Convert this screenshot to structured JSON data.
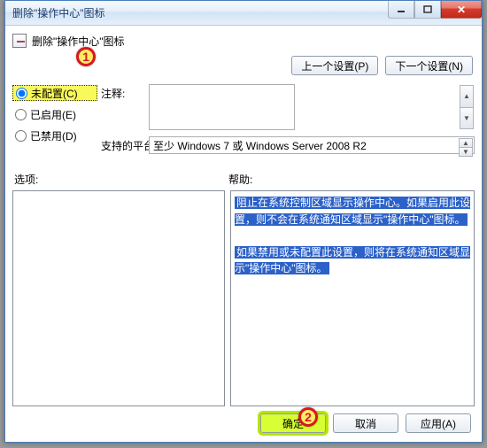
{
  "window": {
    "title": "删除\"操作中心\"图标",
    "header_text": "删除\"操作中心\"图标"
  },
  "nav": {
    "prev": "上一个设置(P)",
    "next": "下一个设置(N)"
  },
  "radios": {
    "not_configured": "未配置(C)",
    "enabled": "已启用(E)",
    "disabled": "已禁用(D)"
  },
  "labels": {
    "comment": "注释:",
    "platform": "支持的平台:",
    "options": "选项:",
    "help": "帮助:"
  },
  "platform_value": "至少 Windows 7 或 Windows Server 2008 R2",
  "help_text": {
    "p1": "阻止在系统控制区域显示操作中心。如果启用此设置，则不会在系统通知区域显示\"操作中心\"图标。",
    "p2": "如果禁用或未配置此设置，则将在系统通知区域显示\"操作中心\"图标。"
  },
  "buttons": {
    "ok": "确定",
    "cancel": "取消",
    "apply": "应用(A)"
  },
  "callouts": {
    "one": "1",
    "two": "2"
  }
}
